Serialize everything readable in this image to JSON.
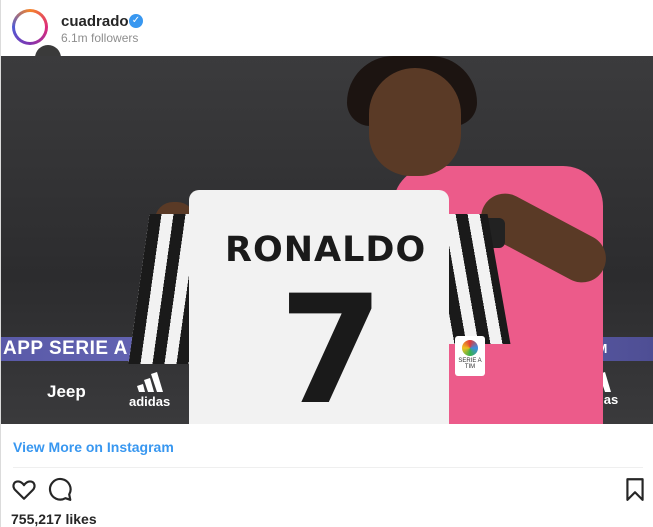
{
  "header": {
    "username": "cuadrado",
    "verified_symbol": "✓",
    "followers": "6.1m followers"
  },
  "photo": {
    "banner_text": "APP SERIE A",
    "banner_right": "TIM",
    "sponsors_left": [
      "Jeep",
      "adidas"
    ],
    "sponsors_right": [
      "adidas"
    ],
    "jersey_name": "RONALDO",
    "jersey_number": "7",
    "badge_text": "SERIE A TIM"
  },
  "footer": {
    "view_more": "View More on Instagram",
    "likes": "755,217 likes"
  },
  "icons": {
    "like": "heart-icon",
    "comment": "comment-icon",
    "save": "bookmark-icon"
  },
  "colors": {
    "link": "#3897f0",
    "verified": "#3897f0"
  }
}
